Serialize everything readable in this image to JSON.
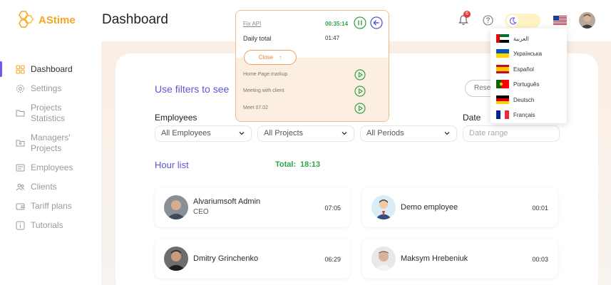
{
  "header": {
    "logo_text": "AStime",
    "page_title": "Dashboard",
    "notification_count": "6"
  },
  "sidebar": {
    "items": [
      {
        "label": "Dashboard",
        "icon": "grid-icon",
        "active": true
      },
      {
        "label": "Settings",
        "icon": "gear-icon"
      },
      {
        "label": "Projects Statistics",
        "icon": "folder-icon"
      },
      {
        "label": "Managers' Projects",
        "icon": "folder-user-icon"
      },
      {
        "label": "Employees",
        "icon": "id-card-icon"
      },
      {
        "label": "Clients",
        "icon": "users-icon"
      },
      {
        "label": "Tariff plans",
        "icon": "wallet-icon"
      },
      {
        "label": "Tutorials",
        "icon": "info-icon"
      }
    ]
  },
  "filters": {
    "title": "Use filters to see",
    "reset_label": "Rese",
    "employees_label": "Employees",
    "employees_value": "All Employees",
    "projects_value": "All Projects",
    "periods_value": "All Periods",
    "date_label": "Date",
    "date_placeholder": "Date range"
  },
  "hour_list": {
    "title": "Hour list",
    "total_label": "Total:",
    "total_value": "18:13",
    "employees": [
      {
        "name": "Alvariumsoft Admin",
        "role": "CEO",
        "time": "07:05"
      },
      {
        "name": "Demo employee",
        "role": "",
        "time": "00:01"
      },
      {
        "name": "Dmitry Grinchenko",
        "role": "",
        "time": "06:29"
      },
      {
        "name": "Maksym Hrebeniuk",
        "role": "",
        "time": "00:03"
      }
    ]
  },
  "timer": {
    "current_task": "Fix API",
    "current_time": "00:35:14",
    "daily_label": "Daily total",
    "daily_value": "01:47",
    "close_label": "Close",
    "tasks": [
      "Home Page markup",
      "Meeting with client",
      "Meet 07.02"
    ]
  },
  "languages": [
    {
      "label": "العربية",
      "flag": "ae"
    },
    {
      "label": "Українська",
      "flag": "ua"
    },
    {
      "label": "Español",
      "flag": "es"
    },
    {
      "label": "Português",
      "flag": "pt"
    },
    {
      "label": "Deutsch",
      "flag": "de"
    },
    {
      "label": "Français",
      "flag": "fr"
    }
  ],
  "colors": {
    "accent": "#5b55d6",
    "brand": "#f5a623",
    "timer_green": "#2ea54a",
    "timer_orange": "#e8862d"
  }
}
